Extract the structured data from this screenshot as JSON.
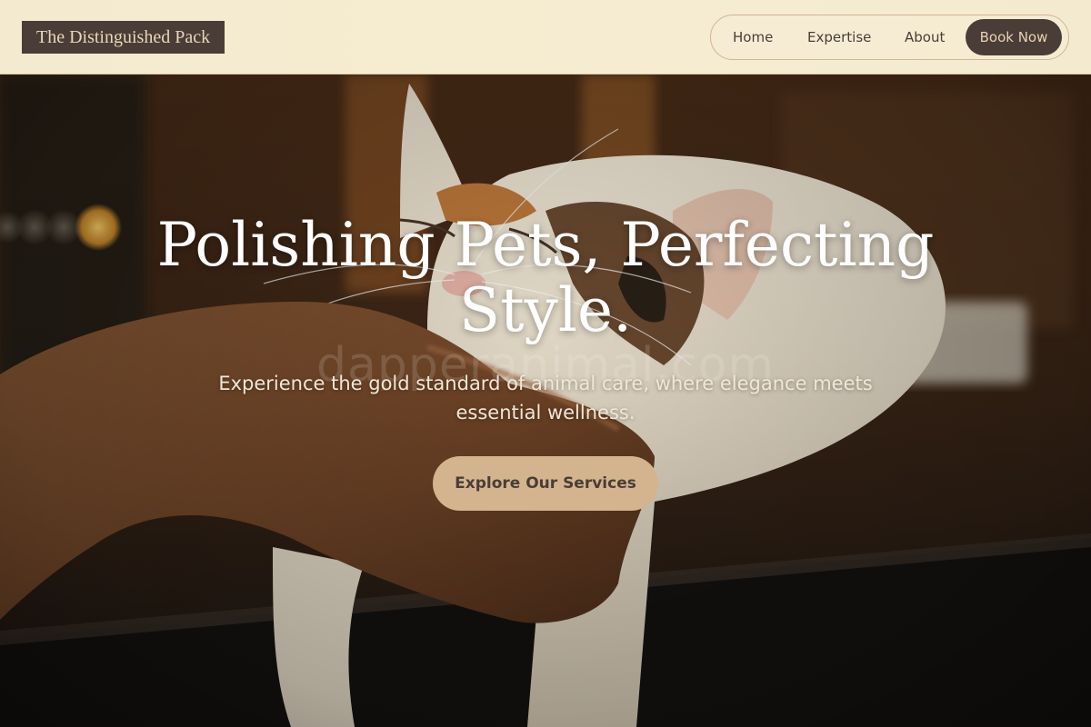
{
  "header": {
    "logo_text": "The Distinguished Pack",
    "nav": {
      "home": "Home",
      "expertise": "Expertise",
      "about": "About",
      "book_now": "Book Now"
    }
  },
  "hero": {
    "title": "Polishing Pets, Perfecting Style.",
    "subtitle": "Experience the gold standard of animal care, where elegance meets essential wellness.",
    "cta_label": "Explore Our Services",
    "watermark": "dapperanimal.com",
    "image_subject": "cat-being-petted-photo"
  },
  "colors": {
    "header_bg": "#f5ecd2",
    "dark_brown": "#4a3d37",
    "accent_tan": "#d4b48e",
    "nav_border": "#d2b594",
    "hero_text": "#ffffff"
  }
}
